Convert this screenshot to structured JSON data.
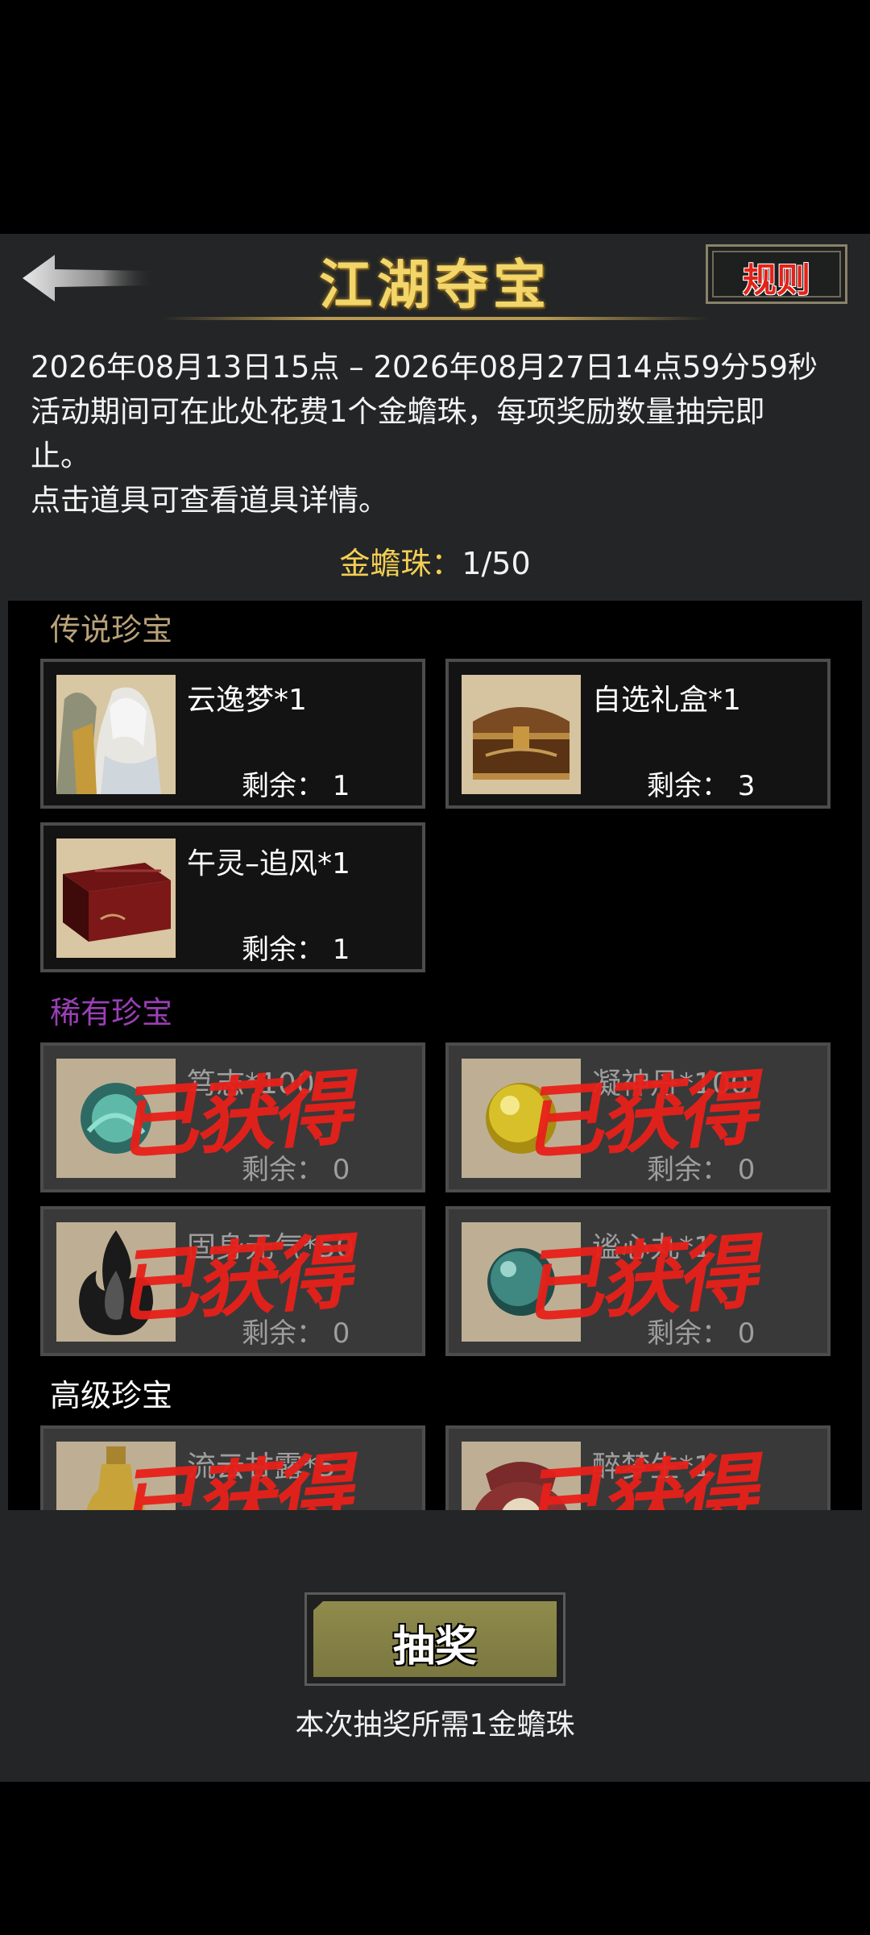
{
  "header": {
    "title": "江湖夺宝",
    "rules_label": "规则"
  },
  "description": {
    "line1": "2026年08月13日15点 – 2026年08月27日14点59分59秒",
    "line2": "活动期间可在此处花费1个金蟾珠，每项奖励数量抽完即",
    "line3": "止。",
    "line4": "点击道具可查看道具详情。"
  },
  "currency": {
    "label": "金蟾珠：",
    "value": "1/50"
  },
  "sections": [
    {
      "title": "传说珍宝",
      "color": "#b9a27a"
    },
    {
      "title": "稀有珍宝",
      "color": "#9a3fb5"
    },
    {
      "title": "高级珍宝",
      "color": "#ffffff"
    }
  ],
  "items": [
    {
      "name": "云逸梦*1",
      "remain": "剩余：  1",
      "image": "heroine-portrait",
      "obtained": false
    },
    {
      "name": "自选礼盒*1",
      "remain": "剩余：  3",
      "image": "wooden-chest-icon",
      "obtained": false
    },
    {
      "name": "午灵–追风*1",
      "remain": "剩余：  1",
      "image": "red-box-icon",
      "obtained": false
    },
    {
      "name": "笃志*100",
      "remain": "剩余：  0",
      "image": "jade-orb-icon",
      "obtained": true
    },
    {
      "name": "凝神丹*100",
      "remain": "剩余：  0",
      "image": "gold-pill-icon",
      "obtained": true
    },
    {
      "name": "固身元气*50",
      "remain": "剩余：  0",
      "image": "black-flame-icon",
      "obtained": true
    },
    {
      "name": "谧心丸*1",
      "remain": "剩余：  0",
      "image": "teal-pill-icon",
      "obtained": true
    },
    {
      "name": "流云甘露*5",
      "remain": "",
      "image": "gourd-bottle-icon",
      "obtained": true
    },
    {
      "name": "醉梦生*1",
      "remain": "",
      "image": "wine-jar-icon",
      "obtained": true
    }
  ],
  "stamp_text": "已获得",
  "footer": {
    "draw_label": "抽奖",
    "draw_note": "本次抽奖所需1金蟾珠"
  }
}
